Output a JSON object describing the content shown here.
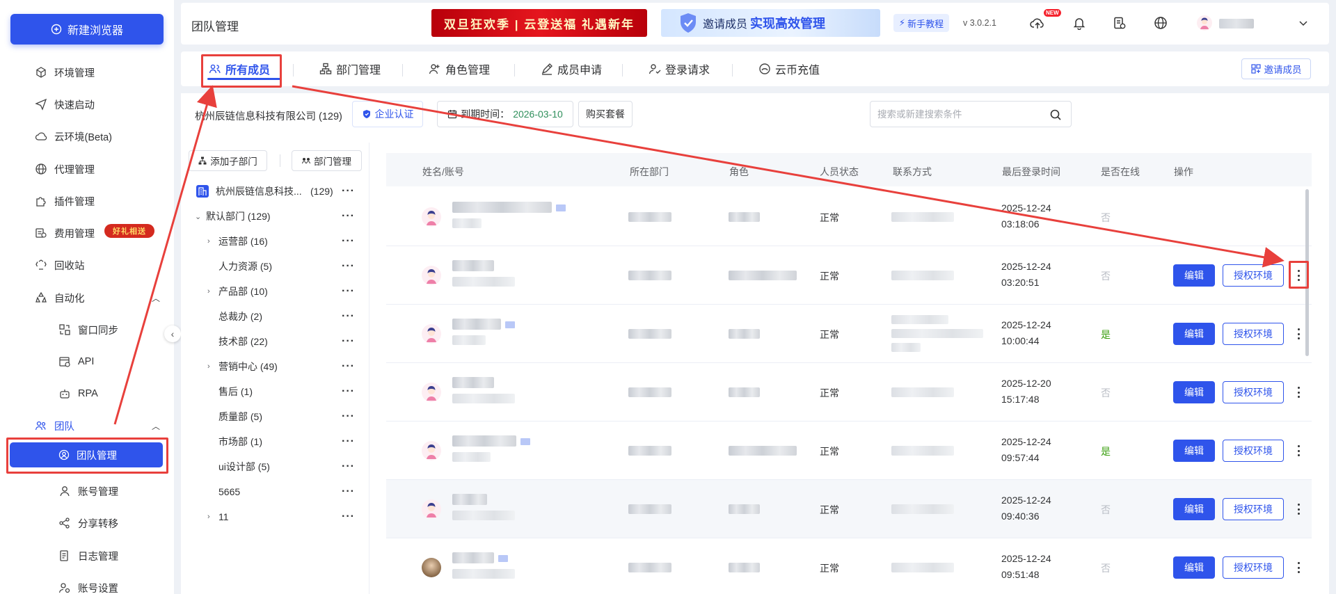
{
  "sidebar": {
    "new_browser_label": "新建浏览器",
    "items": [
      {
        "label": "环境管理",
        "icon": "cube-icon"
      },
      {
        "label": "快速启动",
        "icon": "send-icon"
      },
      {
        "label": "云环境(Beta)",
        "icon": "cloud-icon"
      },
      {
        "label": "代理管理",
        "icon": "globe-icon"
      },
      {
        "label": "插件管理",
        "icon": "puzzle-icon"
      },
      {
        "label": "费用管理",
        "icon": "bill-icon",
        "badge": "好礼相送"
      },
      {
        "label": "回收站",
        "icon": "recycle-icon"
      },
      {
        "label": "自动化",
        "icon": "automation-icon",
        "expanded": true
      },
      {
        "label": "窗口同步",
        "icon": "window-sync-icon"
      },
      {
        "label": "API",
        "icon": "api-icon"
      },
      {
        "label": "RPA",
        "icon": "robot-icon"
      },
      {
        "label": "团队",
        "icon": "team-icon",
        "expanded": true
      },
      {
        "label": "团队管理",
        "icon": "user-circle-icon",
        "active": true
      },
      {
        "label": "账号管理",
        "icon": "user-icon"
      },
      {
        "label": "分享转移",
        "icon": "share-icon"
      },
      {
        "label": "日志管理",
        "icon": "log-icon"
      },
      {
        "label": "账号设置",
        "icon": "user-settings-icon"
      }
    ]
  },
  "header": {
    "title": "团队管理",
    "promo_text": "双旦狂欢季 | 云登送福 礼遇新年",
    "invite_banner_prefix": "邀请成员",
    "invite_banner_highlight": "实现高效管理",
    "tutorial_label": "新手教程",
    "version": "v 3.0.2.1",
    "new_badge": "NEW"
  },
  "tabs": [
    {
      "label": "所有成员",
      "icon": "users-icon",
      "active": true
    },
    {
      "label": "部门管理",
      "icon": "org-icon"
    },
    {
      "label": "角色管理",
      "icon": "user-plus-icon"
    },
    {
      "label": "成员申请",
      "icon": "apply-icon"
    },
    {
      "label": "登录请求",
      "icon": "login-request-icon"
    },
    {
      "label": "云币充值",
      "icon": "coin-icon"
    }
  ],
  "invite_member_label": "邀请成员",
  "toolbar": {
    "company": "杭州辰链信息科技有限公司 (129)",
    "certify_label": "企业认证",
    "expire_prefix": "到期时间：",
    "expire_date": "2026-03-10",
    "buy_label": "购买套餐",
    "search_placeholder": "搜索或新建搜索条件"
  },
  "tree": {
    "add_sub_label": "添加子部门",
    "dept_manage_label": "部门管理",
    "nodes": [
      {
        "label": "杭州辰链信息科技...",
        "count": "(129)",
        "level": 0,
        "root": true
      },
      {
        "label": "默认部门 (129)",
        "level": 1,
        "expandable": true,
        "expanded": true
      },
      {
        "label": "运营部 (16)",
        "level": 2,
        "expandable": true
      },
      {
        "label": "人力资源 (5)",
        "level": 2
      },
      {
        "label": "产品部 (10)",
        "level": 2,
        "expandable": true
      },
      {
        "label": "总裁办 (2)",
        "level": 2
      },
      {
        "label": "技术部 (22)",
        "level": 2
      },
      {
        "label": "营销中心 (49)",
        "level": 2,
        "expandable": true
      },
      {
        "label": "售后 (1)",
        "level": 2
      },
      {
        "label": "质量部 (5)",
        "level": 2
      },
      {
        "label": "市场部 (1)",
        "level": 2
      },
      {
        "label": "ui设计部 (5)",
        "level": 2
      },
      {
        "label": "5665",
        "level": 2
      },
      {
        "label": "11",
        "level": 2,
        "expandable": true
      }
    ]
  },
  "table": {
    "columns": [
      "姓名/账号",
      "所在部门",
      "角色",
      "人员状态",
      "联系方式",
      "最后登录时间",
      "是否在线",
      "操作"
    ],
    "edit_label": "编辑",
    "auth_label": "授权环境",
    "rows": [
      {
        "status": "正常",
        "last_login_date": "2025-12-24",
        "last_login_time": "03:18:06",
        "online": "否",
        "actions": false
      },
      {
        "status": "正常",
        "last_login_date": "2025-12-24",
        "last_login_time": "03:20:51",
        "online": "否",
        "actions": true
      },
      {
        "status": "正常",
        "last_login_date": "2025-12-24",
        "last_login_time": "10:00:44",
        "online": "是",
        "actions": true
      },
      {
        "status": "正常",
        "last_login_date": "2025-12-20",
        "last_login_time": "15:17:48",
        "online": "否",
        "actions": true
      },
      {
        "status": "正常",
        "last_login_date": "2025-12-24",
        "last_login_time": "09:57:44",
        "online": "是",
        "actions": true
      },
      {
        "status": "正常",
        "last_login_date": "2025-12-24",
        "last_login_time": "09:40:36",
        "online": "否",
        "actions": true,
        "hover": true
      },
      {
        "status": "正常",
        "last_login_date": "2025-12-24",
        "last_login_time": "09:51:48",
        "online": "否",
        "actions": true
      }
    ]
  },
  "colors": {
    "accent": "#2f54eb",
    "annotation_red": "#e8403c",
    "online_green": "#389e0d"
  }
}
